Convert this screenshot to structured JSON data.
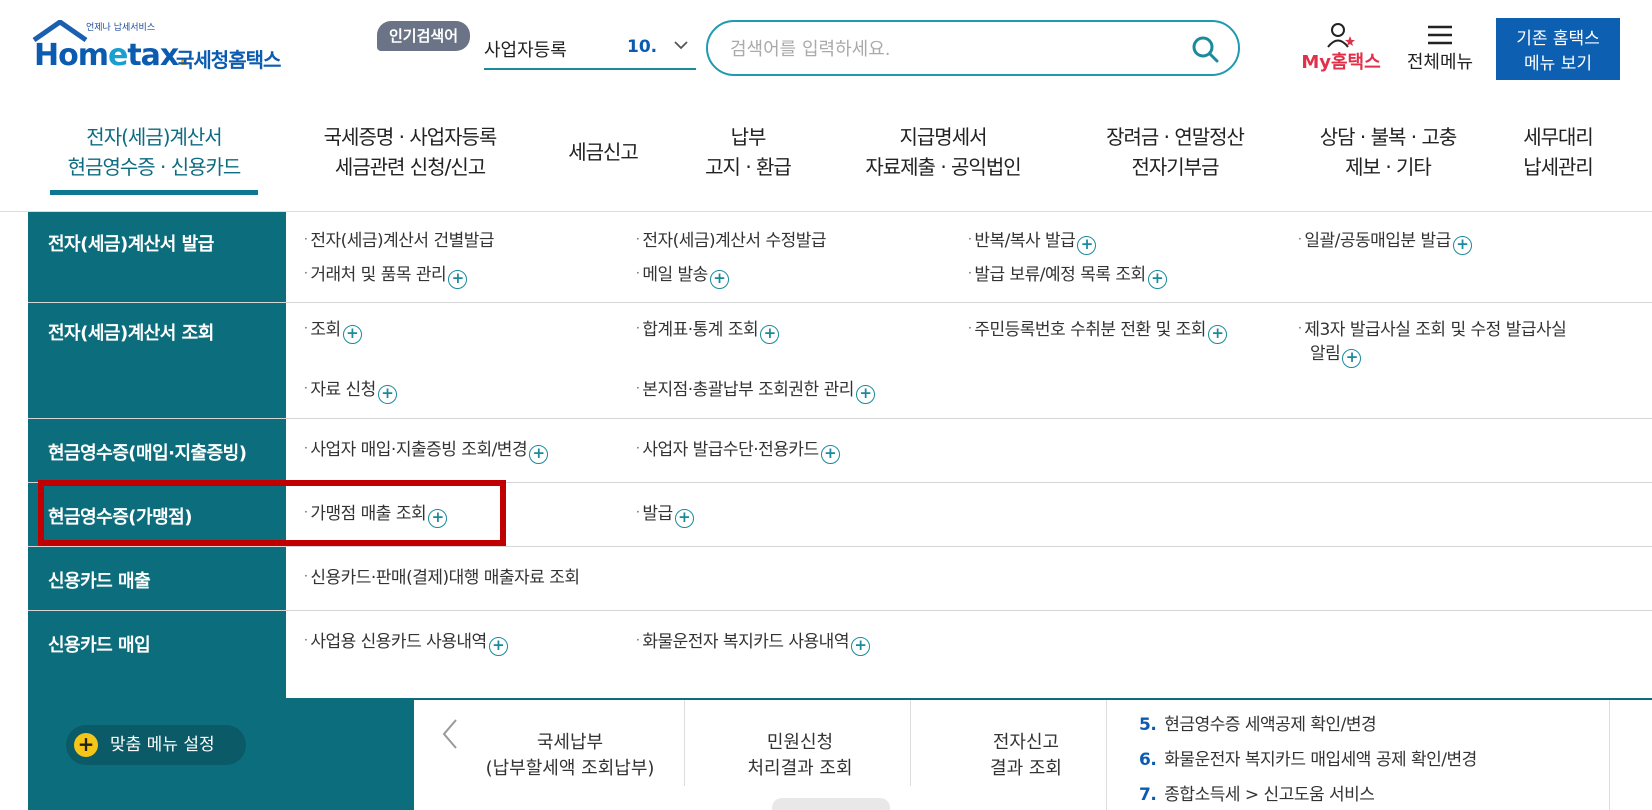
{
  "header": {
    "logo_tag": "언제나 납세서비스",
    "logo_main_pre": "Hom",
    "logo_main_e": "e",
    "logo_main_post": "tax",
    "logo_sub": "국세청홈택스",
    "popular_label": "인기검색어",
    "popular_keyword": "사업자등록",
    "popular_rank": "10.",
    "search_placeholder": "검색어를 입력하세요.",
    "my_label": "My홈택스",
    "allmenu_label": "전체메뉴",
    "oldhome_line1": "기존 홈택스",
    "oldhome_line2": "메뉴 보기"
  },
  "nav": {
    "items": [
      {
        "line1": "전자(세금)계산서",
        "line2": "현금영수증 · 신용카드"
      },
      {
        "line1": "국세증명 · 사업자등록",
        "line2": "세금관련 신청/신고"
      },
      {
        "line1": "세금신고",
        "line2": ""
      },
      {
        "line1": "납부",
        "line2": "고지 · 환급"
      },
      {
        "line1": "지급명세서",
        "line2": "자료제출 · 공익법인"
      },
      {
        "line1": "장려금 · 연말정산",
        "line2": "전자기부금"
      },
      {
        "line1": "상담 · 불복 · 고충",
        "line2": "제보 · 기타"
      },
      {
        "line1": "세무대리",
        "line2": "납세관리"
      }
    ]
  },
  "mega": {
    "rows": [
      {
        "title": "전자(세금)계산서 발급",
        "links": [
          "전자(세금)계산서 건별발급",
          "전자(세금)계산서 수정발급",
          "반복/복사 발급",
          "일괄/공동매입분 발급",
          "거래처 및 품목 관리",
          "메일 발송",
          "발급 보류/예정 목록 조회"
        ]
      },
      {
        "title": "전자(세금)계산서 조회",
        "links": [
          "조회",
          "합계표·통계 조회",
          "주민등록번호 수취분 전환 및 조회",
          "제3자 발급사실 조회 및 수정 발급사실",
          "알림",
          "자료 신청",
          "본지점·총괄납부 조회권한 관리"
        ]
      },
      {
        "title": "현금영수증(매입·지출증빙)",
        "links": [
          "사업자 매입·지출증빙 조회/변경",
          "사업자 발급수단·전용카드"
        ]
      },
      {
        "title": "현금영수증(가맹점)",
        "links": [
          "가맹점 매출 조회",
          "발급"
        ]
      },
      {
        "title": "신용카드 매출",
        "links": [
          "신용카드·판매(결제)대행 매출자료 조회"
        ]
      },
      {
        "title": "신용카드 매입",
        "links": [
          "사업용 신용카드 사용내역",
          "화물운전자 복지카드 사용내역"
        ]
      }
    ]
  },
  "below": {
    "custom_menu": "맞춤 메뉴 설정",
    "quick": [
      {
        "line1": "국세납부",
        "line2": "(납부할세액 조회납부)"
      },
      {
        "line1": "민원신청",
        "line2": "처리결과 조회"
      },
      {
        "line1": "전자신고",
        "line2": "결과 조회"
      }
    ],
    "list": [
      {
        "n": "5.",
        "text": "현금영수증 세액공제 확인/변경"
      },
      {
        "n": "6.",
        "text": "화물운전자 복지카드 매입세액 공제 확인/변경"
      },
      {
        "n": "7.",
        "text": "종합소득세 > 신고도움 서비스"
      }
    ]
  },
  "colors": {
    "teal": "#0c6d7c",
    "blue": "#0d5fb2",
    "highlight": "#c00000",
    "pink": "#e0304a"
  }
}
